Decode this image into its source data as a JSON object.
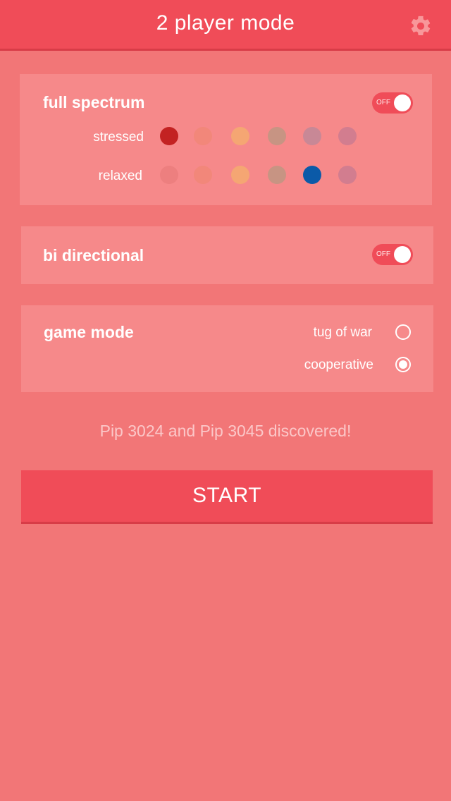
{
  "header": {
    "title": "2 player mode",
    "settings_icon": "gear-icon"
  },
  "full_spectrum": {
    "title": "full spectrum",
    "toggle_label": "OFF",
    "rows": [
      {
        "label": "stressed",
        "colors": [
          "#c32222",
          "#f2877a",
          "#f5a673",
          "#c79483",
          "#c88896",
          "#d27d8f"
        ]
      },
      {
        "label": "relaxed",
        "colors": [
          "#ed7f7f",
          "#f2877a",
          "#f5a673",
          "#c79483",
          "#0b5aa8",
          "#d27d8f"
        ]
      }
    ]
  },
  "bi_directional": {
    "title": "bi directional",
    "toggle_label": "OFF"
  },
  "game_mode": {
    "title": "game mode",
    "options": [
      {
        "label": "tug of war",
        "selected": false
      },
      {
        "label": "cooperative",
        "selected": true
      }
    ]
  },
  "status": "Pip 3024  and Pip 3045 discovered!",
  "start_label": "START",
  "colors": {
    "background": "#f27677",
    "header": "#f04c58",
    "card": "#f6898a",
    "accent": "#f04c58"
  }
}
